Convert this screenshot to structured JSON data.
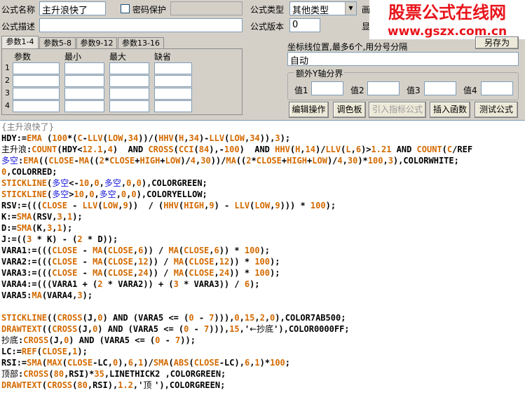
{
  "form": {
    "name_label": "公式名称",
    "name_value": "主升浪快了",
    "password_label": "密码保护",
    "desc_label": "公式描述",
    "type_label": "公式类型",
    "type_value": "其他类型",
    "version_label": "公式版本",
    "version_value": "0",
    "cut_label_1": "画",
    "cut_label_2": "显"
  },
  "tabs": [
    {
      "label": "参数1-4"
    },
    {
      "label": "参数5-8"
    },
    {
      "label": "参数9-12"
    },
    {
      "label": "参数13-16"
    }
  ],
  "param_grid": {
    "headers": [
      "参数",
      "最小",
      "最大",
      "缺省"
    ],
    "rows": [
      "1",
      "2",
      "3",
      "4"
    ]
  },
  "axis": {
    "label": "坐标线位置,最多6个,用分号分隔",
    "value": "自动",
    "group_label": "额外Y轴分界",
    "v1": "值1",
    "v2": "值2",
    "v3": "值3",
    "v4": "值4"
  },
  "buttons": {
    "edit": "编辑操作",
    "palette": "调色板",
    "import_indicator": "引入指标公式",
    "insert_function": "插入函数",
    "test_formula": "测试公式",
    "top_right": "另存为"
  },
  "watermark": {
    "line1": "股票公式在线网",
    "line2": "www.gszx.com.cn",
    "color": "#e8141b"
  },
  "code": [
    [
      [
        "c-g",
        "{主升浪快了}"
      ]
    ],
    [
      [
        "c-v",
        "HDY"
      ],
      [
        "c-k",
        ":="
      ],
      [
        "c-f",
        "EMA"
      ],
      [
        "c-k",
        " ("
      ],
      [
        "c-n",
        "100"
      ],
      [
        "c-k",
        "*("
      ],
      [
        "c-p",
        "C"
      ],
      [
        "c-k",
        "-"
      ],
      [
        "c-f",
        "LLV"
      ],
      [
        "c-k",
        "("
      ],
      [
        "c-p",
        "LOW"
      ],
      [
        "c-k",
        ","
      ],
      [
        "c-n",
        "34"
      ],
      [
        "c-k",
        "))/("
      ],
      [
        "c-f",
        "HHV"
      ],
      [
        "c-k",
        "("
      ],
      [
        "c-p",
        "H"
      ],
      [
        "c-k",
        ","
      ],
      [
        "c-n",
        "34"
      ],
      [
        "c-k",
        ")-"
      ],
      [
        "c-f",
        "LLV"
      ],
      [
        "c-k",
        "("
      ],
      [
        "c-p",
        "LOW"
      ],
      [
        "c-k",
        ","
      ],
      [
        "c-n",
        "34"
      ],
      [
        "c-k",
        ")),"
      ],
      [
        "c-n",
        "3"
      ],
      [
        "c-k",
        ");"
      ]
    ],
    [
      [
        "c-z",
        "主升浪"
      ],
      [
        "c-k",
        ":"
      ],
      [
        "c-f",
        "COUNT"
      ],
      [
        "c-k",
        "(HDY<"
      ],
      [
        "c-n",
        "12.1"
      ],
      [
        "c-k",
        ","
      ],
      [
        "c-n",
        "4"
      ],
      [
        "c-k",
        ")  AND "
      ],
      [
        "c-f",
        "CROSS"
      ],
      [
        "c-k",
        "("
      ],
      [
        "c-f",
        "CCI"
      ],
      [
        "c-k",
        "("
      ],
      [
        "c-n",
        "84"
      ],
      [
        "c-k",
        "),-"
      ],
      [
        "c-n",
        "100"
      ],
      [
        "c-k",
        ")  AND "
      ],
      [
        "c-f",
        "HHV"
      ],
      [
        "c-k",
        "("
      ],
      [
        "c-p",
        "H"
      ],
      [
        "c-k",
        ","
      ],
      [
        "c-n",
        "14"
      ],
      [
        "c-k",
        ")/"
      ],
      [
        "c-f",
        "LLV"
      ],
      [
        "c-k",
        "("
      ],
      [
        "c-p",
        "L"
      ],
      [
        "c-k",
        ","
      ],
      [
        "c-n",
        "6"
      ],
      [
        "c-k",
        ")>"
      ],
      [
        "c-n",
        "1.21"
      ],
      [
        "c-k",
        " AND "
      ],
      [
        "c-f",
        "COUNT"
      ],
      [
        "c-k",
        "("
      ],
      [
        "c-p",
        "C"
      ],
      [
        "c-k",
        "/REF"
      ]
    ],
    [
      [
        "c-y",
        "多空"
      ],
      [
        "c-k",
        ":"
      ],
      [
        "c-f",
        "EMA"
      ],
      [
        "c-k",
        "(("
      ],
      [
        "c-p",
        "CLOSE"
      ],
      [
        "c-k",
        "-"
      ],
      [
        "c-f",
        "MA"
      ],
      [
        "c-k",
        "(("
      ],
      [
        "c-n",
        "2"
      ],
      [
        "c-k",
        "*"
      ],
      [
        "c-p",
        "CLOSE"
      ],
      [
        "c-k",
        "+"
      ],
      [
        "c-p",
        "HIGH"
      ],
      [
        "c-k",
        "+"
      ],
      [
        "c-p",
        "LOW"
      ],
      [
        "c-k",
        ")/"
      ],
      [
        "c-n",
        "4"
      ],
      [
        "c-k",
        ","
      ],
      [
        "c-n",
        "30"
      ],
      [
        "c-k",
        "))/"
      ],
      [
        "c-f",
        "MA"
      ],
      [
        "c-k",
        "(("
      ],
      [
        "c-n",
        "2"
      ],
      [
        "c-k",
        "*"
      ],
      [
        "c-p",
        "CLOSE"
      ],
      [
        "c-k",
        "+"
      ],
      [
        "c-p",
        "HIGH"
      ],
      [
        "c-k",
        "+"
      ],
      [
        "c-p",
        "LOW"
      ],
      [
        "c-k",
        ")/"
      ],
      [
        "c-n",
        "4"
      ],
      [
        "c-k",
        ","
      ],
      [
        "c-n",
        "30"
      ],
      [
        "c-k",
        ")*"
      ],
      [
        "c-n",
        "100"
      ],
      [
        "c-k",
        ","
      ],
      [
        "c-n",
        "3"
      ],
      [
        "c-k",
        "),COLORWHITE;"
      ]
    ],
    [
      [
        "c-n",
        "0"
      ],
      [
        "c-k",
        ",COLORRED;"
      ]
    ],
    [
      [
        "c-f",
        "STICKLINE"
      ],
      [
        "c-k",
        "("
      ],
      [
        "c-y",
        "多空"
      ],
      [
        "c-k",
        "<-"
      ],
      [
        "c-n",
        "10"
      ],
      [
        "c-k",
        ","
      ],
      [
        "c-n",
        "0"
      ],
      [
        "c-k",
        ","
      ],
      [
        "c-y",
        "多空"
      ],
      [
        "c-k",
        ","
      ],
      [
        "c-n",
        "0"
      ],
      [
        "c-k",
        ","
      ],
      [
        "c-n",
        "0"
      ],
      [
        "c-k",
        "),COLORGREEN;"
      ]
    ],
    [
      [
        "c-f",
        "STICKLINE"
      ],
      [
        "c-k",
        "("
      ],
      [
        "c-y",
        "多空"
      ],
      [
        "c-k",
        ">"
      ],
      [
        "c-n",
        "10"
      ],
      [
        "c-k",
        ","
      ],
      [
        "c-n",
        "0"
      ],
      [
        "c-k",
        ","
      ],
      [
        "c-y",
        "多空"
      ],
      [
        "c-k",
        ","
      ],
      [
        "c-n",
        "0"
      ],
      [
        "c-k",
        ","
      ],
      [
        "c-n",
        "0"
      ],
      [
        "c-k",
        "),COLORYELLOW;"
      ]
    ],
    [
      [
        "c-v",
        "RSV"
      ],
      [
        "c-k",
        ":=((("
      ],
      [
        "c-p",
        "CLOSE"
      ],
      [
        "c-k",
        " - "
      ],
      [
        "c-f",
        "LLV"
      ],
      [
        "c-k",
        "("
      ],
      [
        "c-p",
        "LOW"
      ],
      [
        "c-k",
        ","
      ],
      [
        "c-n",
        "9"
      ],
      [
        "c-k",
        "))  / ("
      ],
      [
        "c-f",
        "HHV"
      ],
      [
        "c-k",
        "("
      ],
      [
        "c-p",
        "HIGH"
      ],
      [
        "c-k",
        ","
      ],
      [
        "c-n",
        "9"
      ],
      [
        "c-k",
        ") - "
      ],
      [
        "c-f",
        "LLV"
      ],
      [
        "c-k",
        "("
      ],
      [
        "c-p",
        "LOW"
      ],
      [
        "c-k",
        ","
      ],
      [
        "c-n",
        "9"
      ],
      [
        "c-k",
        "))) * "
      ],
      [
        "c-n",
        "100"
      ],
      [
        "c-k",
        ");"
      ]
    ],
    [
      [
        "c-v",
        "K"
      ],
      [
        "c-k",
        ":="
      ],
      [
        "c-f",
        "SMA"
      ],
      [
        "c-k",
        "(RSV,"
      ],
      [
        "c-n",
        "3"
      ],
      [
        "c-k",
        ","
      ],
      [
        "c-n",
        "1"
      ],
      [
        "c-k",
        ");"
      ]
    ],
    [
      [
        "c-v",
        "D"
      ],
      [
        "c-k",
        ":="
      ],
      [
        "c-f",
        "SMA"
      ],
      [
        "c-k",
        "(K,"
      ],
      [
        "c-n",
        "3"
      ],
      [
        "c-k",
        ","
      ],
      [
        "c-n",
        "1"
      ],
      [
        "c-k",
        ");"
      ]
    ],
    [
      [
        "c-v",
        "J"
      ],
      [
        "c-k",
        ":=(("
      ],
      [
        "c-n",
        "3"
      ],
      [
        "c-k",
        " * K) - ("
      ],
      [
        "c-n",
        "2"
      ],
      [
        "c-k",
        " * D));"
      ]
    ],
    [
      [
        "c-v",
        "VARA1"
      ],
      [
        "c-k",
        ":=((("
      ],
      [
        "c-p",
        "CLOSE"
      ],
      [
        "c-k",
        " - "
      ],
      [
        "c-f",
        "MA"
      ],
      [
        "c-k",
        "("
      ],
      [
        "c-p",
        "CLOSE"
      ],
      [
        "c-k",
        ","
      ],
      [
        "c-n",
        "6"
      ],
      [
        "c-k",
        ")) / "
      ],
      [
        "c-f",
        "MA"
      ],
      [
        "c-k",
        "("
      ],
      [
        "c-p",
        "CLOSE"
      ],
      [
        "c-k",
        ","
      ],
      [
        "c-n",
        "6"
      ],
      [
        "c-k",
        ")) * "
      ],
      [
        "c-n",
        "100"
      ],
      [
        "c-k",
        ");"
      ]
    ],
    [
      [
        "c-v",
        "VARA2"
      ],
      [
        "c-k",
        ":=((("
      ],
      [
        "c-p",
        "CLOSE"
      ],
      [
        "c-k",
        " - "
      ],
      [
        "c-f",
        "MA"
      ],
      [
        "c-k",
        "("
      ],
      [
        "c-p",
        "CLOSE"
      ],
      [
        "c-k",
        ","
      ],
      [
        "c-n",
        "12"
      ],
      [
        "c-k",
        ")) / "
      ],
      [
        "c-f",
        "MA"
      ],
      [
        "c-k",
        "("
      ],
      [
        "c-p",
        "CLOSE"
      ],
      [
        "c-k",
        ","
      ],
      [
        "c-n",
        "12"
      ],
      [
        "c-k",
        ")) * "
      ],
      [
        "c-n",
        "100"
      ],
      [
        "c-k",
        ");"
      ]
    ],
    [
      [
        "c-v",
        "VARA3"
      ],
      [
        "c-k",
        ":=((("
      ],
      [
        "c-p",
        "CLOSE"
      ],
      [
        "c-k",
        " - "
      ],
      [
        "c-f",
        "MA"
      ],
      [
        "c-k",
        "("
      ],
      [
        "c-p",
        "CLOSE"
      ],
      [
        "c-k",
        ","
      ],
      [
        "c-n",
        "24"
      ],
      [
        "c-k",
        ")) / "
      ],
      [
        "c-f",
        "MA"
      ],
      [
        "c-k",
        "("
      ],
      [
        "c-p",
        "CLOSE"
      ],
      [
        "c-k",
        ","
      ],
      [
        "c-n",
        "24"
      ],
      [
        "c-k",
        ")) * "
      ],
      [
        "c-n",
        "100"
      ],
      [
        "c-k",
        ");"
      ]
    ],
    [
      [
        "c-v",
        "VARA4"
      ],
      [
        "c-k",
        ":=(((VARA1 + ("
      ],
      [
        "c-n",
        "2"
      ],
      [
        "c-k",
        " * VARA2)) + ("
      ],
      [
        "c-n",
        "3"
      ],
      [
        "c-k",
        " * VARA3)) / "
      ],
      [
        "c-n",
        "6"
      ],
      [
        "c-k",
        ");"
      ]
    ],
    [
      [
        "c-v",
        "VARA5"
      ],
      [
        "c-k",
        ":"
      ],
      [
        "c-f",
        "MA"
      ],
      [
        "c-k",
        "(VARA4,"
      ],
      [
        "c-n",
        "3"
      ],
      [
        "c-k",
        ");"
      ]
    ],
    [],
    [
      [
        "c-f",
        "STICKLINE"
      ],
      [
        "c-k",
        "(("
      ],
      [
        "c-f",
        "CROSS"
      ],
      [
        "c-k",
        "(J,"
      ],
      [
        "c-n",
        "0"
      ],
      [
        "c-k",
        ") AND (VARA5 <= ("
      ],
      [
        "c-n",
        "0"
      ],
      [
        "c-k",
        " - "
      ],
      [
        "c-n",
        "7"
      ],
      [
        "c-k",
        "))),"
      ],
      [
        "c-n",
        "0"
      ],
      [
        "c-k",
        ","
      ],
      [
        "c-n",
        "15"
      ],
      [
        "c-k",
        ","
      ],
      [
        "c-n",
        "2"
      ],
      [
        "c-k",
        ","
      ],
      [
        "c-n",
        "0"
      ],
      [
        "c-k",
        "),COLOR7AB500;"
      ]
    ],
    [
      [
        "c-f",
        "DRAWTEXT"
      ],
      [
        "c-k",
        "(("
      ],
      [
        "c-f",
        "CROSS"
      ],
      [
        "c-k",
        "(J,"
      ],
      [
        "c-n",
        "0"
      ],
      [
        "c-k",
        ") AND (VARA5 <= ("
      ],
      [
        "c-n",
        "0"
      ],
      [
        "c-k",
        " - "
      ],
      [
        "c-n",
        "7"
      ],
      [
        "c-k",
        "))),"
      ],
      [
        "c-n",
        "15"
      ],
      [
        "c-k",
        ",'"
      ],
      [
        "c-z",
        "←抄底"
      ],
      [
        "c-k",
        "'),COLOR0000FF;"
      ]
    ],
    [
      [
        "c-z",
        "抄底"
      ],
      [
        "c-k",
        ":"
      ],
      [
        "c-f",
        "CROSS"
      ],
      [
        "c-k",
        "(J,"
      ],
      [
        "c-n",
        "0"
      ],
      [
        "c-k",
        ") AND (VARA5 <= ("
      ],
      [
        "c-n",
        "0"
      ],
      [
        "c-k",
        " - "
      ],
      [
        "c-n",
        "7"
      ],
      [
        "c-k",
        "));"
      ]
    ],
    [
      [
        "c-v",
        "LC"
      ],
      [
        "c-k",
        ":="
      ],
      [
        "c-f",
        "REF"
      ],
      [
        "c-k",
        "("
      ],
      [
        "c-p",
        "CLOSE"
      ],
      [
        "c-k",
        ","
      ],
      [
        "c-n",
        "1"
      ],
      [
        "c-k",
        ");"
      ]
    ],
    [
      [
        "c-v",
        "RSI"
      ],
      [
        "c-k",
        ":="
      ],
      [
        "c-f",
        "SMA"
      ],
      [
        "c-k",
        "("
      ],
      [
        "c-f",
        "MAX"
      ],
      [
        "c-k",
        "("
      ],
      [
        "c-p",
        "CLOSE"
      ],
      [
        "c-k",
        "-LC,"
      ],
      [
        "c-n",
        "0"
      ],
      [
        "c-k",
        "),"
      ],
      [
        "c-n",
        "6"
      ],
      [
        "c-k",
        ","
      ],
      [
        "c-n",
        "1"
      ],
      [
        "c-k",
        ")/"
      ],
      [
        "c-f",
        "SMA"
      ],
      [
        "c-k",
        "("
      ],
      [
        "c-f",
        "ABS"
      ],
      [
        "c-k",
        "("
      ],
      [
        "c-p",
        "CLOSE"
      ],
      [
        "c-k",
        "-LC),"
      ],
      [
        "c-n",
        "6"
      ],
      [
        "c-k",
        ","
      ],
      [
        "c-n",
        "1"
      ],
      [
        "c-k",
        ")*"
      ],
      [
        "c-n",
        "100"
      ],
      [
        "c-k",
        ";"
      ]
    ],
    [
      [
        "c-z",
        "顶部"
      ],
      [
        "c-k",
        ":"
      ],
      [
        "c-f",
        "CROSS"
      ],
      [
        "c-k",
        "("
      ],
      [
        "c-n",
        "80"
      ],
      [
        "c-k",
        ",RSI)*"
      ],
      [
        "c-n",
        "35"
      ],
      [
        "c-k",
        ",LINETHICK2 ,COLORGREEN;"
      ]
    ],
    [
      [
        "c-f",
        "DRAWTEXT"
      ],
      [
        "c-k",
        "("
      ],
      [
        "c-f",
        "CROSS"
      ],
      [
        "c-k",
        "("
      ],
      [
        "c-n",
        "80"
      ],
      [
        "c-k",
        ",RSI),"
      ],
      [
        "c-n",
        "1.2"
      ],
      [
        "c-k",
        ",'"
      ],
      [
        "c-z",
        "顶 "
      ],
      [
        "c-k",
        "'),COLORGREEN;"
      ]
    ]
  ]
}
